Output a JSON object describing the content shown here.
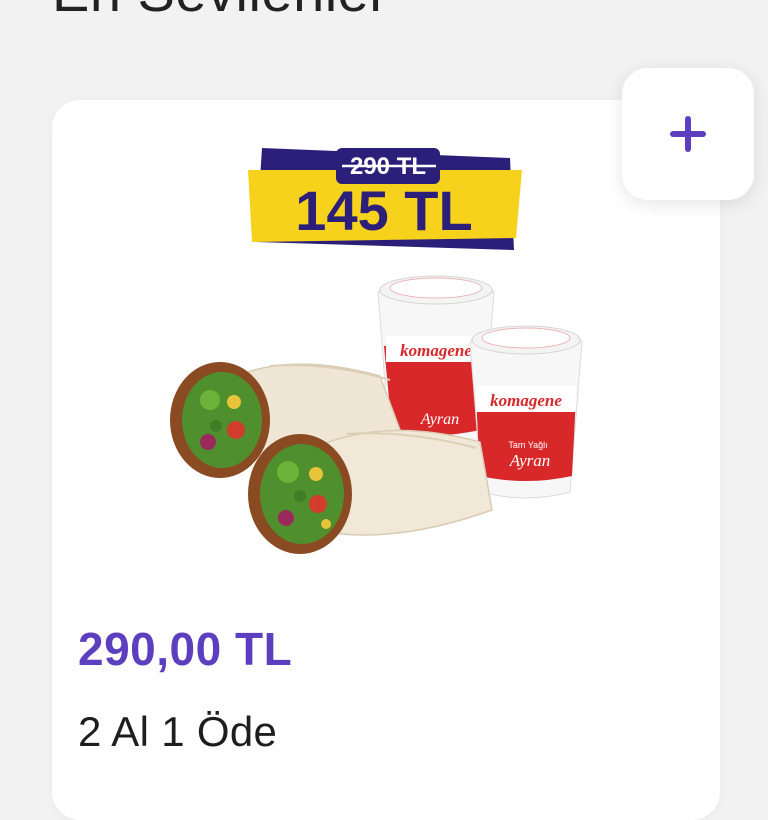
{
  "section": {
    "title": "En Sevilenler"
  },
  "card": {
    "add_button": {
      "icon": "plus-icon",
      "color": "#5b3fbe"
    },
    "image": {
      "badge_old_price": "290 TL",
      "badge_new_price": "145 TL",
      "cup_brand": "komagene",
      "cup_product": "Ayran",
      "cup_tagline": "Tam Yağlı"
    },
    "price": "290,00 TL",
    "name": "2 Al 1 Öde"
  },
  "colors": {
    "accent": "#5b3fbe",
    "badge_yellow": "#f7d21c",
    "badge_navy": "#2c1f7a",
    "cup_red": "#d8282a"
  }
}
